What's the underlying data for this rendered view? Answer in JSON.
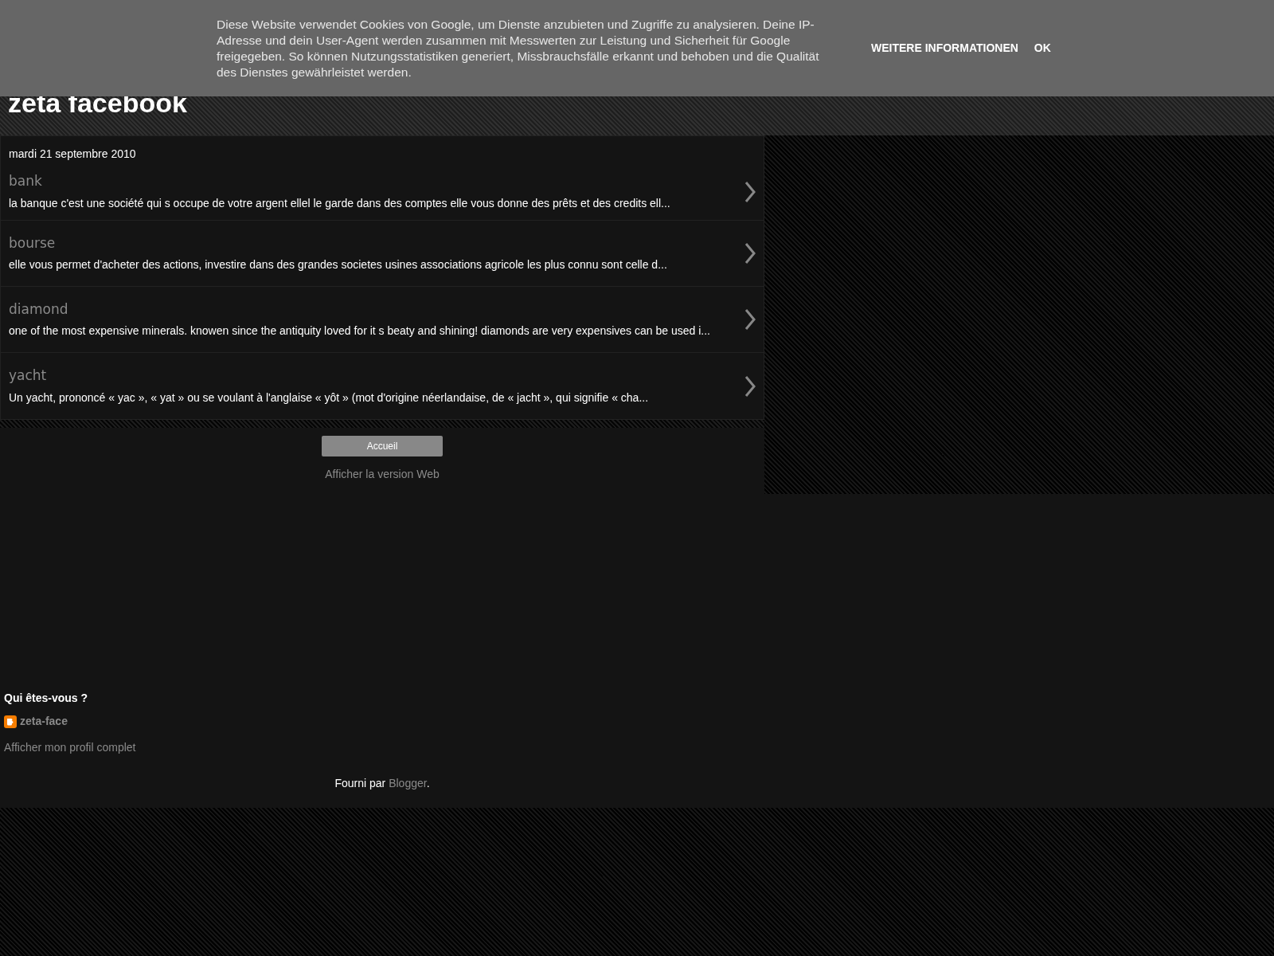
{
  "cookie_banner": {
    "message": "Diese Website verwendet Cookies von Google, um Dienste anzubieten und Zugriffe zu analysieren. Deine IP-Adresse und dein User-Agent werden zusammen mit Messwerten zur Leistung und Sicherheit für Google freigegeben. So können Nutzungsstatistiken generiert, Missbrauchsfälle erkannt und behoben und die Qualität des Dienstes gewährleistet werden.",
    "buttons": [
      "WEITERE INFORMATIONEN",
      "OK"
    ]
  },
  "blog_title": "zeta facebook",
  "date": "mardi 21 septembre 2010",
  "posts": [
    {
      "title": "bank",
      "snippet": "la banque c'est une société qui s occupe de votre argent ellel le garde dans des comptes elle vous donne des prêts et des credits ell..."
    },
    {
      "title": "bourse",
      "snippet": "elle vous permet d'acheter des actions, investire dans des grandes societes usines associations agricole les plus connu sont celle d..."
    },
    {
      "title": "diamond",
      "snippet": "one of the most expensive minerals. knowen since the antiquity loved for it s beaty and shining! diamonds are very expensives can be used i..."
    },
    {
      "title": "yacht",
      "snippet": "Un yacht, prononcé « yac », « yat » ou se voulant à l'anglaise « yôt » (mot d'origine néerlandaise, de « jacht », qui signifie « cha..."
    }
  ],
  "home_button": "Accueil",
  "web_version_link": "Afficher la version Web",
  "profile": {
    "heading": "Qui êtes-vous ?",
    "name": "zeta-face",
    "link": "Afficher mon profil complet"
  },
  "footer": {
    "prefix": "Fourni par ",
    "link": "Blogger",
    "suffix": "."
  }
}
